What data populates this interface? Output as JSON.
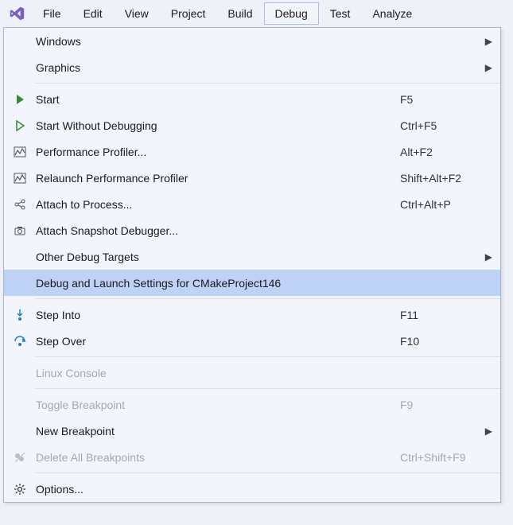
{
  "menubar": {
    "items": [
      {
        "label": "File"
      },
      {
        "label": "Edit"
      },
      {
        "label": "View"
      },
      {
        "label": "Project"
      },
      {
        "label": "Build"
      },
      {
        "label": "Debug"
      },
      {
        "label": "Test"
      },
      {
        "label": "Analyze"
      }
    ],
    "active_index": 5
  },
  "dropdown": {
    "items": [
      {
        "label": "Windows",
        "shortcut": "",
        "icon": "none",
        "submenu": true
      },
      {
        "label": "Graphics",
        "shortcut": "",
        "icon": "none",
        "submenu": true
      },
      {
        "sep": true
      },
      {
        "label": "Start",
        "shortcut": "F5",
        "icon": "start"
      },
      {
        "label": "Start Without Debugging",
        "shortcut": "Ctrl+F5",
        "icon": "start-outline"
      },
      {
        "label": "Performance Profiler...",
        "shortcut": "Alt+F2",
        "icon": "profiler"
      },
      {
        "label": "Relaunch Performance Profiler",
        "shortcut": "Shift+Alt+F2",
        "icon": "profiler"
      },
      {
        "label": "Attach to Process...",
        "shortcut": "Ctrl+Alt+P",
        "icon": "attach"
      },
      {
        "label": "Attach Snapshot Debugger...",
        "shortcut": "",
        "icon": "snapshot"
      },
      {
        "label": "Other Debug Targets",
        "shortcut": "",
        "icon": "none",
        "submenu": true
      },
      {
        "label": "Debug and Launch Settings for CMakeProject146",
        "shortcut": "",
        "icon": "none",
        "highlighted": true
      },
      {
        "sep": true
      },
      {
        "label": "Step Into",
        "shortcut": "F11",
        "icon": "step-into"
      },
      {
        "label": "Step Over",
        "shortcut": "F10",
        "icon": "step-over"
      },
      {
        "sep": true
      },
      {
        "label": "Linux Console",
        "shortcut": "",
        "icon": "none",
        "disabled": true
      },
      {
        "sep": true
      },
      {
        "label": "Toggle Breakpoint",
        "shortcut": "F9",
        "icon": "none",
        "disabled": true
      },
      {
        "label": "New Breakpoint",
        "shortcut": "",
        "icon": "none",
        "submenu": true
      },
      {
        "label": "Delete All Breakpoints",
        "shortcut": "Ctrl+Shift+F9",
        "icon": "delete-bp",
        "disabled": true
      },
      {
        "sep": true
      },
      {
        "label": "Options...",
        "shortcut": "",
        "icon": "options"
      }
    ]
  }
}
